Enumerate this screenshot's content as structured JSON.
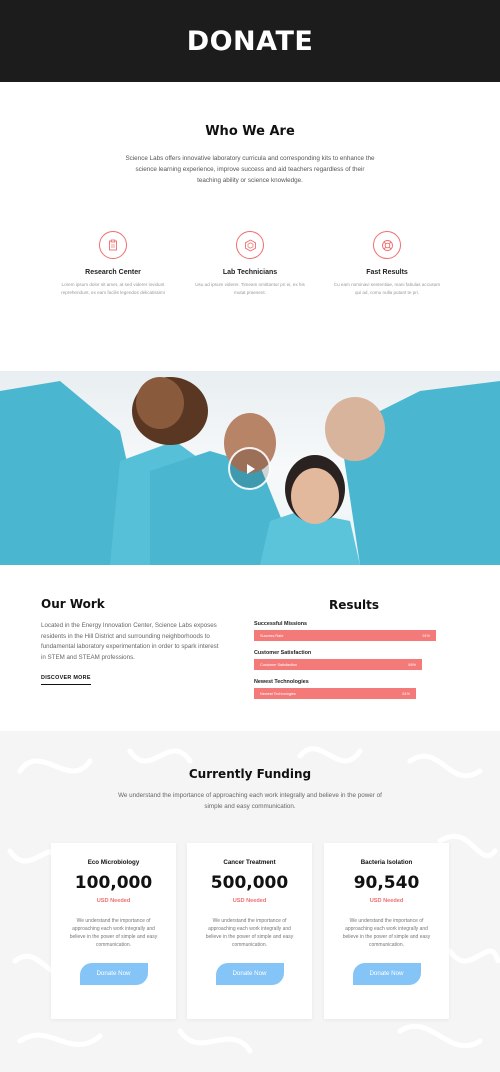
{
  "hero": {
    "title": "DONATE"
  },
  "who": {
    "title": "Who We Are",
    "text": "Science Labs offers innovative laboratory curricula and corresponding kits to enhance the science learning experience, improve success and aid teachers regardless of their teaching ability or science knowledge."
  },
  "features": [
    {
      "icon": "clipboard-icon",
      "title": "Research Center",
      "text": "Lorem ipsum dolor sit amet, at sed viderer invidunt reprehendunt, ex eam facilis legendos delicatissimi"
    },
    {
      "icon": "hexagon-icon",
      "title": "Lab Technicians",
      "text": "Usu ad ipsum viderer. Timeam omittantur pri ei, ex his mutat praesent."
    },
    {
      "icon": "lifebuoy-icon",
      "title": "Fast Results",
      "text": "Cu eam nominavi sententiae, mani fabulas accusam qui ad, comu nulla putant te pri."
    }
  ],
  "work": {
    "title": "Our Work",
    "text": "Located in the Energy Innovation Center, Science Labs exposes residents in the Hill District and surrounding neighborhoods to fundamental laboratory experimentation in order to spark interest in STEM and STEAM professions.",
    "cta": "DISCOVER MORE"
  },
  "results": {
    "title": "Results",
    "bars": [
      {
        "label": "Successful Missions",
        "inner": "Success Rate",
        "percent": "91%",
        "value": 0.91
      },
      {
        "label": "Customer Satisfaction",
        "inner": "Customer Satisfaction",
        "percent": "84%",
        "value": 0.84
      },
      {
        "label": "Newest Technologies",
        "inner": "Newest Technologies",
        "percent": "81%",
        "value": 0.81
      }
    ]
  },
  "funding": {
    "title": "Currently Funding",
    "text": "We understand the importance of approaching each work integrally and believe in the power of simple and easy communication.",
    "cards": [
      {
        "title": "Eco Microbiology",
        "amount": "100,000",
        "need": "USD Needed",
        "text": "We understand the importance of approaching each work integrally and believe in the power of simple and easy communication.",
        "button": "Donate Now"
      },
      {
        "title": "Cancer Treatment",
        "amount": "500,000",
        "need": "USD Needed",
        "text": "We understand the importance of approaching each work integrally and believe in the power of simple and easy communication.",
        "button": "Donate Now"
      },
      {
        "title": "Bacteria Isolation",
        "amount": "90,540",
        "need": "USD Needed",
        "text": "We understand the importance of approaching each work integrally and believe in the power of simple and easy communication.",
        "button": "Donate Now"
      }
    ]
  },
  "colors": {
    "accent": "#f06e6e",
    "bar": "#f47a7a",
    "button": "#84c4f7",
    "hero_bg": "#1c1c1c",
    "shirt": "#4ab6cf"
  },
  "media": {
    "play_icon": "play-icon"
  }
}
